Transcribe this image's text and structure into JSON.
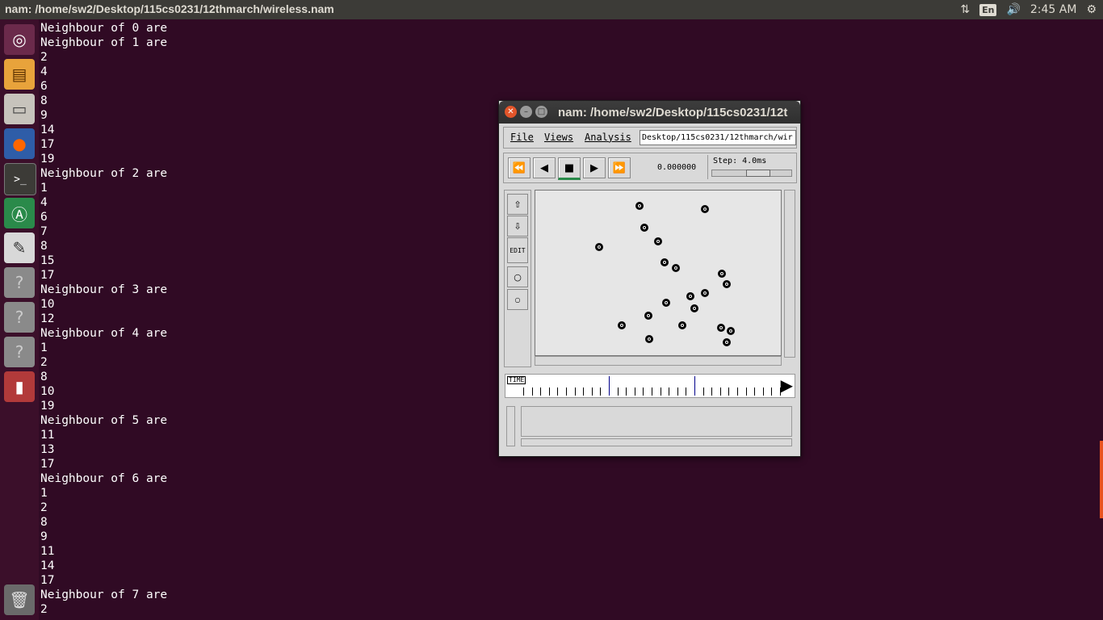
{
  "topbar": {
    "title": "nam: /home/sw2/Desktop/115cs0231/12thmarch/wireless.nam",
    "keyboard": "En",
    "time": "2:45 AM"
  },
  "launcher": {
    "items": [
      "ubuntu-logo",
      "files-doc",
      "file-manager",
      "firefox",
      "terminal",
      "software-updater",
      "text-editor",
      "unknown-app",
      "unknown-app",
      "unknown-app",
      "usb-drive",
      "trash"
    ]
  },
  "terminal": {
    "lines": [
      "Neighbour of 0 are",
      "Neighbour of 1 are",
      "2",
      "4",
      "6",
      "8",
      "9",
      "14",
      "17",
      "19",
      "Neighbour of 2 are",
      "1",
      "4",
      "6",
      "7",
      "8",
      "15",
      "17",
      "Neighbour of 3 are",
      "10",
      "12",
      "Neighbour of 4 are",
      "1",
      "2",
      "8",
      "10",
      "19",
      "Neighbour of 5 are",
      "11",
      "13",
      "17",
      "Neighbour of 6 are",
      "1",
      "2",
      "8",
      "9",
      "11",
      "14",
      "17",
      "Neighbour of 7 are",
      "2"
    ]
  },
  "nam": {
    "title": "nam: /home/sw2/Desktop/115cs0231/12t",
    "menu": {
      "file": "File",
      "views": "Views",
      "analysis": "Analysis"
    },
    "path": "Desktop/115cs0231/12thmarch/wir",
    "time_value": "0.000000",
    "step_label": "Step: 4.0ms",
    "edit_label": "EDIT",
    "timeline_label": "TIME",
    "node_count": 20
  }
}
